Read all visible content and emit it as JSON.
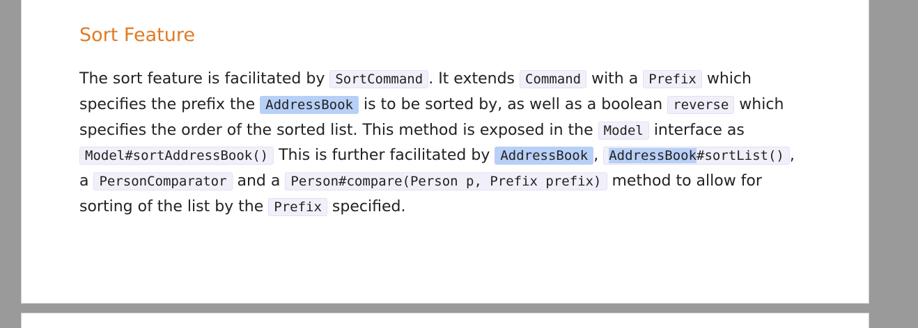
{
  "section": {
    "title": "Sort Feature"
  },
  "paragraph": {
    "t1": "The sort feature is facilitated by ",
    "c1": "SortCommand",
    "t2": ". It extends ",
    "c2": "Command",
    "t3": " with a ",
    "c3": "Prefix",
    "t4": " which specifies the prefix the ",
    "c4": "AddressBook",
    "t5": " is to be sorted by, as well as a boolean ",
    "c5": "reverse",
    "t6": " which specifies the order of the sorted list. This method is exposed in the ",
    "c6": "Model",
    "t7": " interface as ",
    "c7": "Model#sortAddressBook()",
    "t8": " This is further facilitated by ",
    "c8": "AddressBook",
    "t9": ", ",
    "c9a": "AddressBook",
    "c9b": "#sortList()",
    "t10": ", a ",
    "c10": "PersonComparator",
    "t11": " and a ",
    "c11": "Person#compare(Person p, Prefix prefix)",
    "t12": " method to allow for sorting of the list by the ",
    "c12": "Prefix",
    "t13": " specified."
  },
  "colors": {
    "heading": "#e07b24",
    "selection": "#b8d0f7",
    "code_background": "#f1f0fa",
    "viewer_background": "#9a9a9a"
  }
}
